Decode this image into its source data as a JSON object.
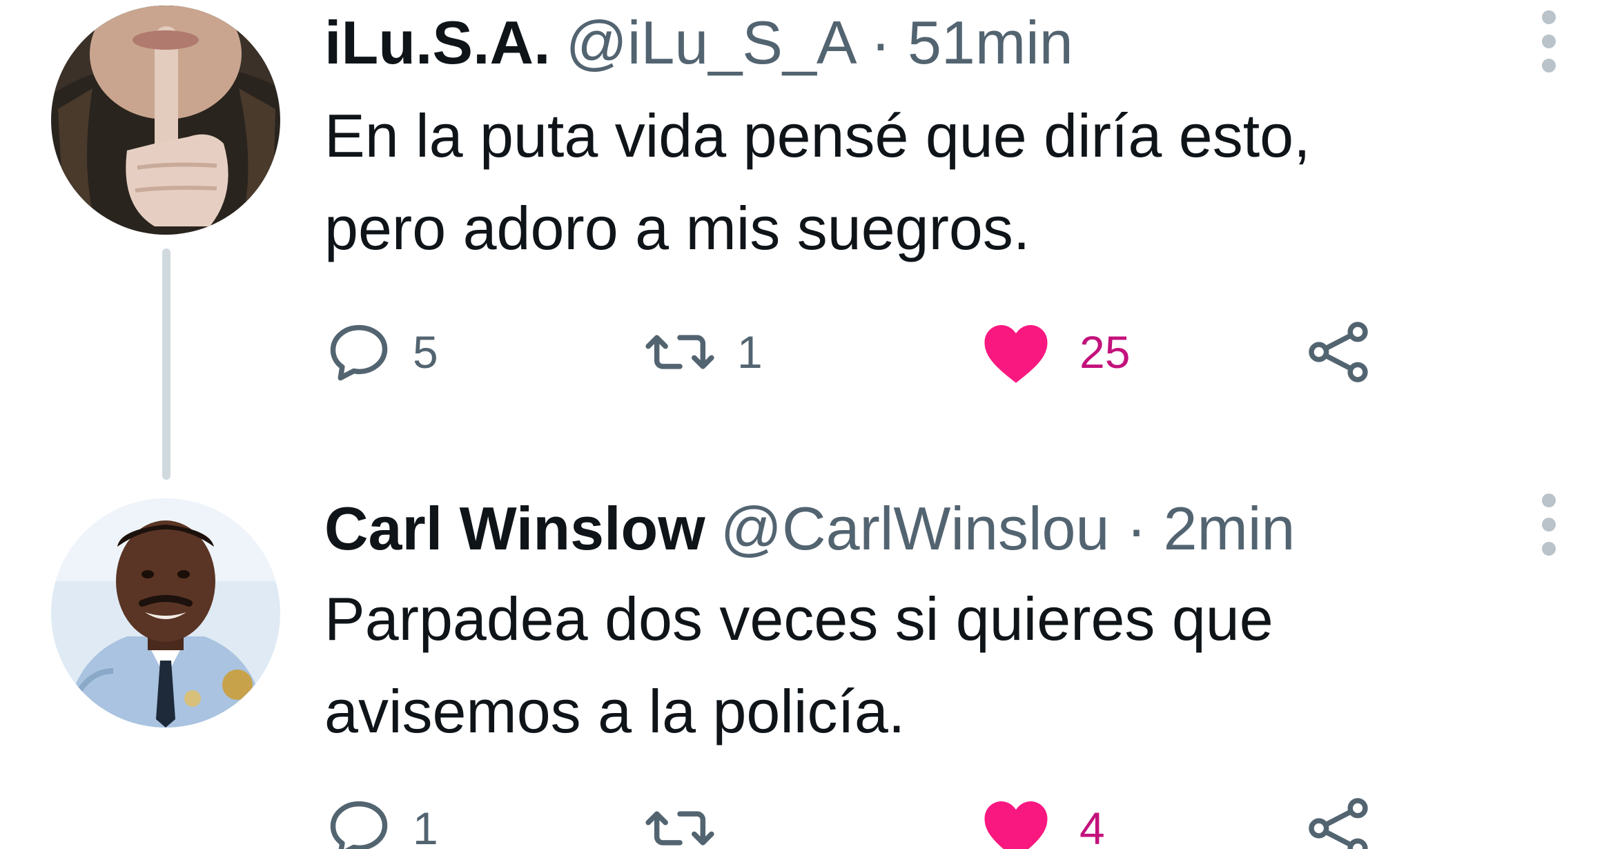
{
  "colors": {
    "text": "#0f1419",
    "muted": "#536471",
    "like_fill": "#f91880",
    "like_count": "#c3127c",
    "thread_line": "#cfd9de"
  },
  "tweets": [
    {
      "display_name": "iLu.S.A.",
      "handle": "@iLu_S_A",
      "separator": "·",
      "time": "51min",
      "text_line_1": "En la puta vida pensé que diría esto,",
      "text_line_2": "pero adoro a mis suegros.",
      "replies": "5",
      "retweets": "1",
      "likes": "25",
      "liked": true
    },
    {
      "display_name": "Carl Winslow",
      "handle": "@CarlWinslou",
      "separator": "·",
      "time": "2min",
      "text_line_1": "Parpadea dos veces si quieres que",
      "text_line_2": "avisemos a la policía.",
      "replies": "1",
      "retweets": "",
      "likes": "4",
      "liked": true
    }
  ],
  "icons": {
    "reply": "reply-icon",
    "retweet": "retweet-icon",
    "like": "heart-icon",
    "share": "share-icon",
    "more": "more-vertical-icon"
  }
}
